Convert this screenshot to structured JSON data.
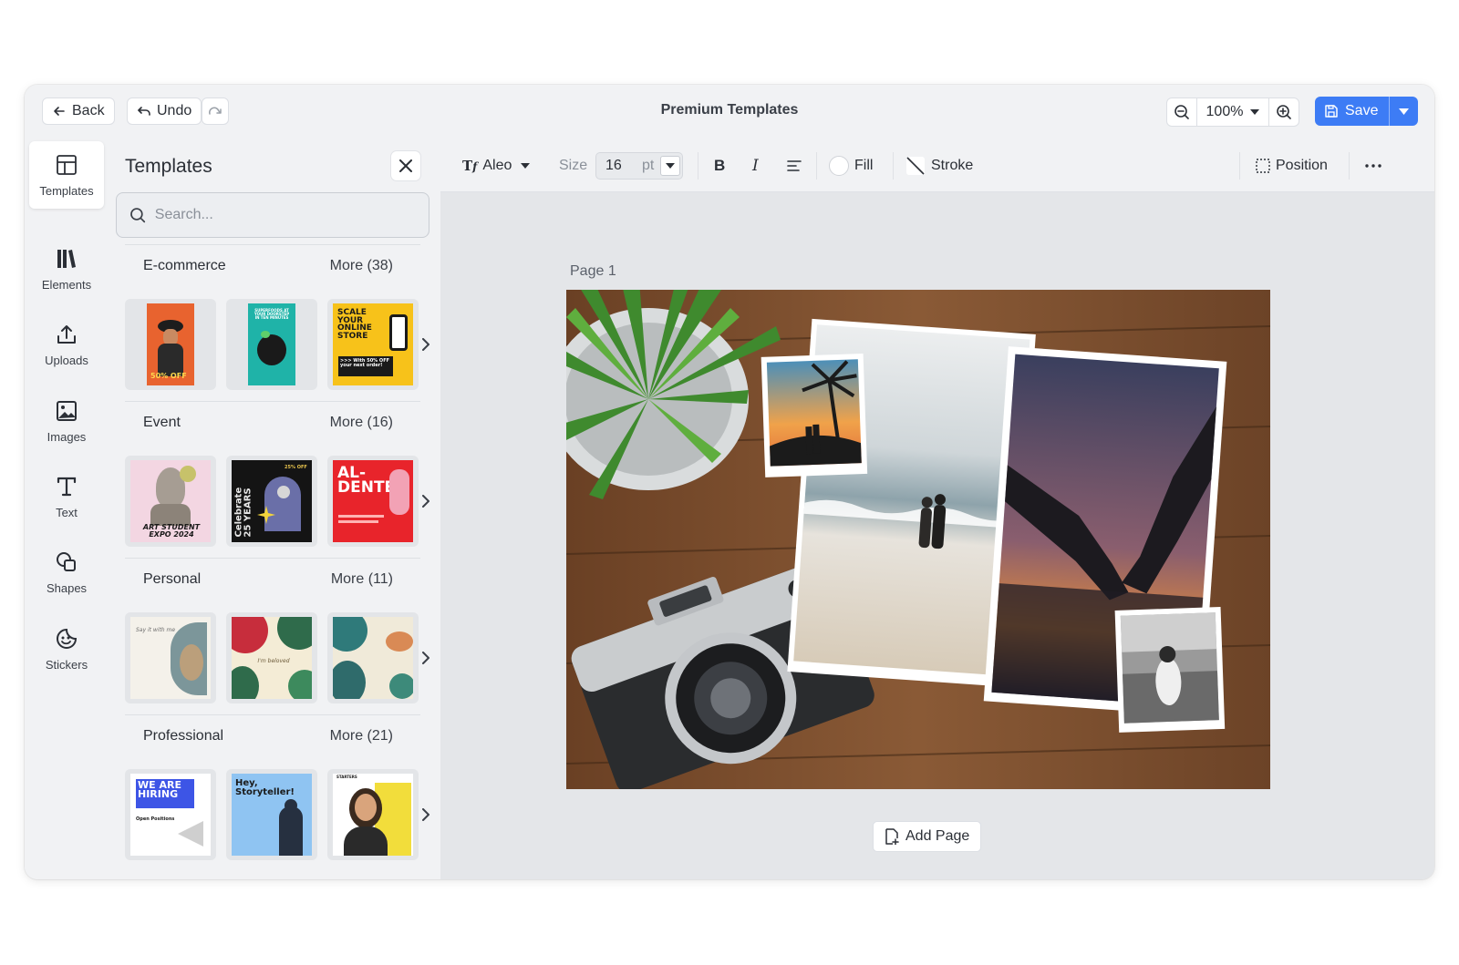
{
  "header": {
    "back_label": "Back",
    "undo_label": "Undo",
    "title": "Premium Templates",
    "zoom_value": "100%",
    "save_label": "Save"
  },
  "rail": {
    "items": [
      {
        "label": "Templates",
        "icon": "layout-icon",
        "active": true
      },
      {
        "label": "Elements",
        "icon": "library-icon"
      },
      {
        "label": "Uploads",
        "icon": "upload-icon"
      },
      {
        "label": "Images",
        "icon": "image-icon"
      },
      {
        "label": "Text",
        "icon": "text-icon"
      },
      {
        "label": "Shapes",
        "icon": "shapes-icon"
      },
      {
        "label": "Stickers",
        "icon": "sticker-icon"
      }
    ]
  },
  "panel": {
    "title": "Templates",
    "search_placeholder": "Search...",
    "categories": [
      {
        "name": "E-commerce",
        "more": "More (38)",
        "thumbs": [
          {
            "text": "50% OFF",
            "bg": "#e8632f"
          },
          {
            "text": "SUPERFOODS AT YOUR DOORSTEP IN TEN MINUTES",
            "bg": "#1fb3a8"
          },
          {
            "text": "SCALE YOUR ONLINE STORE",
            "sub": ">>> With 50% OFF your next order!",
            "bg": "#f7c21a"
          }
        ]
      },
      {
        "name": "Event",
        "more": "More (16)",
        "thumbs": [
          {
            "text": "ART STUDENT EXPO 2024",
            "bg": "#f3d6e2"
          },
          {
            "text": "Celebrate 25 YEARS",
            "sub": "25% OFF",
            "bg": "#141414"
          },
          {
            "text": "AL-DENTE",
            "bg": "#e8242b"
          }
        ]
      },
      {
        "name": "Personal",
        "more": "More (11)",
        "thumbs": [
          {
            "text": "Say it with me",
            "bg": "#f4f1ea"
          },
          {
            "text": "I'm beloved",
            "bg": "#f4ecd6"
          },
          {
            "text": "",
            "bg": "#f0ead9"
          }
        ]
      },
      {
        "name": "Professional",
        "more": "More (21)",
        "thumbs": [
          {
            "text": "WE ARE HIRING",
            "sub": "Open Positions",
            "bg": "#ffffff"
          },
          {
            "text": "Hey, Storyteller!",
            "bg": "#8fc4f2"
          },
          {
            "text": "STARTERS",
            "bg": "#ffffff"
          }
        ]
      }
    ]
  },
  "toolbar": {
    "font_name": "Aleo",
    "size_label": "Size",
    "size_value": "16",
    "size_unit": "pt",
    "bold": "B",
    "italic": "I",
    "fill_label": "Fill",
    "stroke_label": "Stroke",
    "position_label": "Position"
  },
  "canvas": {
    "page_label": "Page  1",
    "add_page_label": "Add Page"
  },
  "colors": {
    "accent": "#3d7cf5",
    "wood": "#7a4d2c",
    "sunset": "#e38b3b"
  }
}
